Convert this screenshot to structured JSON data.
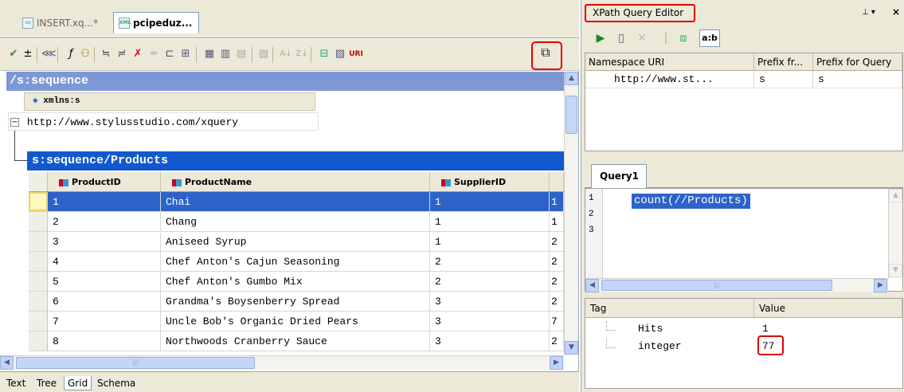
{
  "left": {
    "doc_tabs": [
      {
        "label": "INSERT.xq...*"
      },
      {
        "label": "pcipeduz..."
      }
    ],
    "sequence_header": "/s:sequence",
    "xmlns_header": "xmlns:s",
    "namespace_value": "http://www.stylusstudio.com/xquery",
    "products_header": "s:sequence/Products",
    "grid": {
      "columns": [
        "ProductID",
        "ProductName",
        "SupplierID"
      ],
      "rows": [
        {
          "id": "1",
          "name": "Chai",
          "supplier": "1",
          "extra": "1"
        },
        {
          "id": "2",
          "name": "Chang",
          "supplier": "1",
          "extra": "1"
        },
        {
          "id": "3",
          "name": "Aniseed Syrup",
          "supplier": "1",
          "extra": "2"
        },
        {
          "id": "4",
          "name": "Chef Anton's Cajun Seasoning",
          "supplier": "2",
          "extra": "2"
        },
        {
          "id": "5",
          "name": "Chef Anton's Gumbo Mix",
          "supplier": "2",
          "extra": "2"
        },
        {
          "id": "6",
          "name": "Grandma's Boysenberry Spread",
          "supplier": "3",
          "extra": "2"
        },
        {
          "id": "7",
          "name": "Uncle Bob's Organic Dried Pears",
          "supplier": "3",
          "extra": "7"
        },
        {
          "id": "8",
          "name": "Northwoods Cranberry Sauce",
          "supplier": "3",
          "extra": "2"
        }
      ]
    },
    "view_tabs": [
      "Text",
      "Tree",
      "Grid",
      "Schema"
    ]
  },
  "right": {
    "title": "XPath Query Editor",
    "ab_label": "a:b",
    "namespace_table": {
      "headers": [
        "Namespace URI",
        "Prefix fr...",
        "Prefix for Query"
      ],
      "rows": [
        {
          "uri": "http://www.st...",
          "prefix_from": "s",
          "prefix_query": "s"
        }
      ]
    },
    "query_tab": "Query1",
    "editor": {
      "line_numbers": [
        "1",
        "2",
        "3"
      ],
      "code": "count(//Products)"
    },
    "results": {
      "headers": [
        "Tag",
        "Value"
      ],
      "rows": [
        {
          "tag": "Hits",
          "value": "1"
        },
        {
          "tag": "integer",
          "value": "77"
        }
      ]
    }
  },
  "colors": {
    "sequence_header_bg": "#7d98d5",
    "products_header_bg": "#1259d0",
    "selection_bg": "#2d63c8",
    "highlight_red": "#e00000"
  }
}
